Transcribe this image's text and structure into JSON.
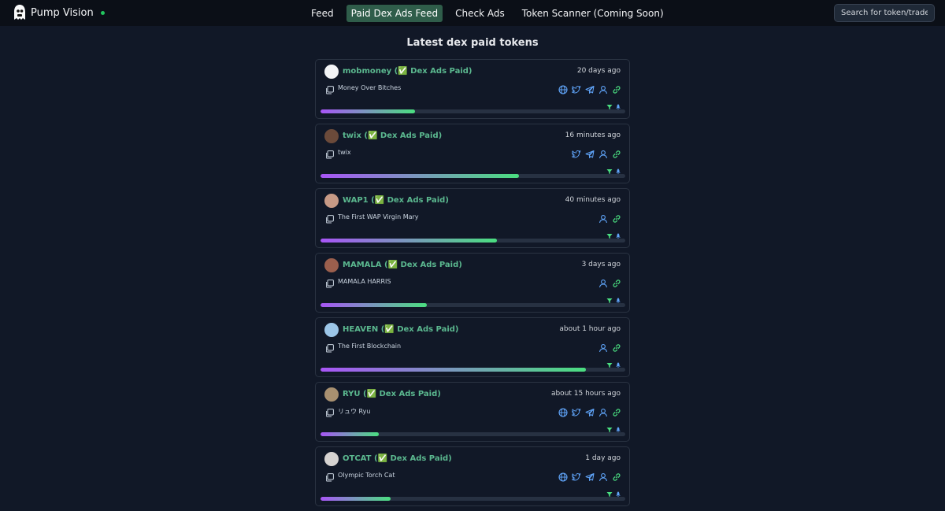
{
  "app": {
    "name": "Pump Vision",
    "logo": "ghost-logo-icon",
    "status_color": "#22c55e"
  },
  "nav": [
    {
      "label": "Feed",
      "active": false
    },
    {
      "label": "Paid Dex Ads Feed",
      "active": true
    },
    {
      "label": "Check Ads",
      "active": false
    },
    {
      "label": "Token Scanner (Coming Soon)",
      "active": false
    }
  ],
  "search": {
    "placeholder": "Search for token/trader",
    "value": ""
  },
  "page_title": "Latest dex paid tokens",
  "colors": {
    "accent": "#5bb88f",
    "active_nav": "#2f5d4a",
    "bar_start": "#a855f7",
    "bar_end": "#4ade80",
    "icon": "#60a5fa"
  },
  "tokens": [
    {
      "symbol": "mobmoney",
      "badge": "(✅ Dex Ads Paid)",
      "time": "20 days ago",
      "description": "Money Over Bitches",
      "socials": [
        "globe-icon",
        "twitter-icon",
        "telegram-icon",
        "user-icon",
        "link-icon"
      ],
      "progress": 0.31,
      "avatar_color": "#f3f4f6"
    },
    {
      "symbol": "twix",
      "badge": "(✅ Dex Ads Paid)",
      "time": "16 minutes ago",
      "description": "twix",
      "socials": [
        "twitter-icon",
        "telegram-icon",
        "user-icon",
        "link-icon"
      ],
      "progress": 0.65,
      "avatar_color": "#6b4a3a"
    },
    {
      "symbol": "WAP1",
      "badge": "(✅ Dex Ads Paid)",
      "time": "40 minutes ago",
      "description": "The First WAP Virgin Mary",
      "socials": [
        "user-icon",
        "link-icon"
      ],
      "progress": 0.58,
      "avatar_color": "#c79a86"
    },
    {
      "symbol": "MAMALA",
      "badge": "(✅ Dex Ads Paid)",
      "time": "3 days ago",
      "description": "MAMALA HARRIS",
      "socials": [
        "user-icon",
        "link-icon"
      ],
      "progress": 0.35,
      "avatar_color": "#9b5f4d"
    },
    {
      "symbol": "HEAVEN",
      "badge": "(✅ Dex Ads Paid)",
      "time": "about 1 hour ago",
      "description": "The First Blockchain",
      "socials": [
        "user-icon",
        "link-icon"
      ],
      "progress": 0.87,
      "avatar_color": "#9cc6e8"
    },
    {
      "symbol": "RYU",
      "badge": "(✅ Dex Ads Paid)",
      "time": "about 15 hours ago",
      "description": "リュウ Ryu",
      "socials": [
        "globe-icon",
        "twitter-icon",
        "telegram-icon",
        "user-icon",
        "link-icon"
      ],
      "progress": 0.19,
      "avatar_color": "#a89070"
    },
    {
      "symbol": "OTCAT",
      "badge": "(✅ Dex Ads Paid)",
      "time": "1 day ago",
      "description": "Olympic Torch Cat",
      "socials": [
        "globe-icon",
        "twitter-icon",
        "telegram-icon",
        "user-icon",
        "link-icon"
      ],
      "progress": 0.23,
      "avatar_color": "#d6d3d1"
    }
  ]
}
